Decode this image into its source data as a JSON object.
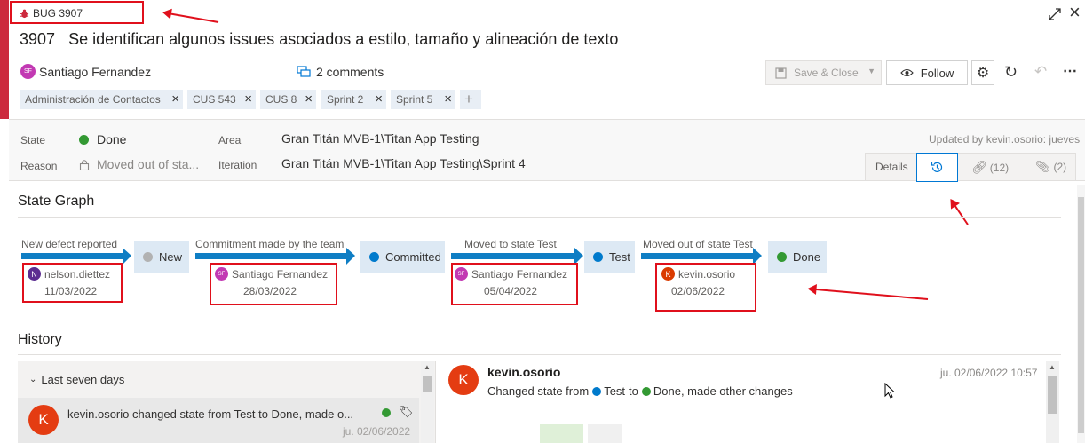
{
  "header": {
    "type_label": "BUG 3907",
    "id": "3907",
    "title": "Se identifican algunos issues asociados a estilo, tamaño y alineación de texto",
    "author": "Santiago Fernandez",
    "author_initials": "SF",
    "comments": "2 comments",
    "save_close": "Save & Close",
    "follow": "Follow"
  },
  "tags": [
    "Administración de Contactos",
    "CUS 543",
    "CUS 8",
    "Sprint 2",
    "Sprint 5"
  ],
  "fields": {
    "state_label": "State",
    "state_value": "Done",
    "reason_label": "Reason",
    "reason_value": "Moved out of sta...",
    "area_label": "Area",
    "area_value": "Gran Titán MVB-1\\Titan App Testing",
    "iteration_label": "Iteration",
    "iteration_value": "Gran Titán MVB-1\\Titan App Testing\\Sprint 4",
    "updated_by": "Updated by kevin.osorio: jueves"
  },
  "view_tabs": {
    "details": "Details",
    "links": "(12)",
    "attachments": "(2)"
  },
  "state_graph": {
    "title": "State Graph",
    "transitions": [
      {
        "label": "New defect reported",
        "user": "nelson.diettez",
        "initials": "N",
        "date": "11/03/2022",
        "color": "#5c2d91"
      },
      {
        "label": "Commitment made by the team",
        "user": "Santiago Fernandez",
        "initials": "SF",
        "date": "28/03/2022",
        "color": "#c239b3"
      },
      {
        "label": "Moved to state Test",
        "user": "Santiago Fernandez",
        "initials": "SF",
        "date": "05/04/2022",
        "color": "#c239b3"
      },
      {
        "label": "Moved out of state Test",
        "user": "kevin.osorio",
        "initials": "K",
        "date": "02/06/2022",
        "color": "#da3b01"
      }
    ],
    "states": [
      {
        "name": "New",
        "color": "#b2b2b2"
      },
      {
        "name": "Committed",
        "color": "#007acc"
      },
      {
        "name": "Test",
        "color": "#007acc"
      },
      {
        "name": "Done",
        "color": "#339933"
      }
    ]
  },
  "history": {
    "title": "History",
    "group": "Last seven days",
    "item_text": "kevin.osorio changed state from Test to Done, made o...",
    "item_date": "ju. 02/06/2022",
    "avatar": "K",
    "detail_user": "kevin.osorio",
    "detail_date": "ju. 02/06/2022 10:57",
    "detail_prefix": "Changed state from",
    "detail_from": "Test",
    "detail_to_word": "to",
    "detail_to": "Done",
    "detail_suffix": ", made other changes"
  },
  "colors": {
    "bug_red": "#cc293d",
    "annotation_red": "#e0101c",
    "state_blue": "#007acc",
    "done_green": "#339933"
  }
}
